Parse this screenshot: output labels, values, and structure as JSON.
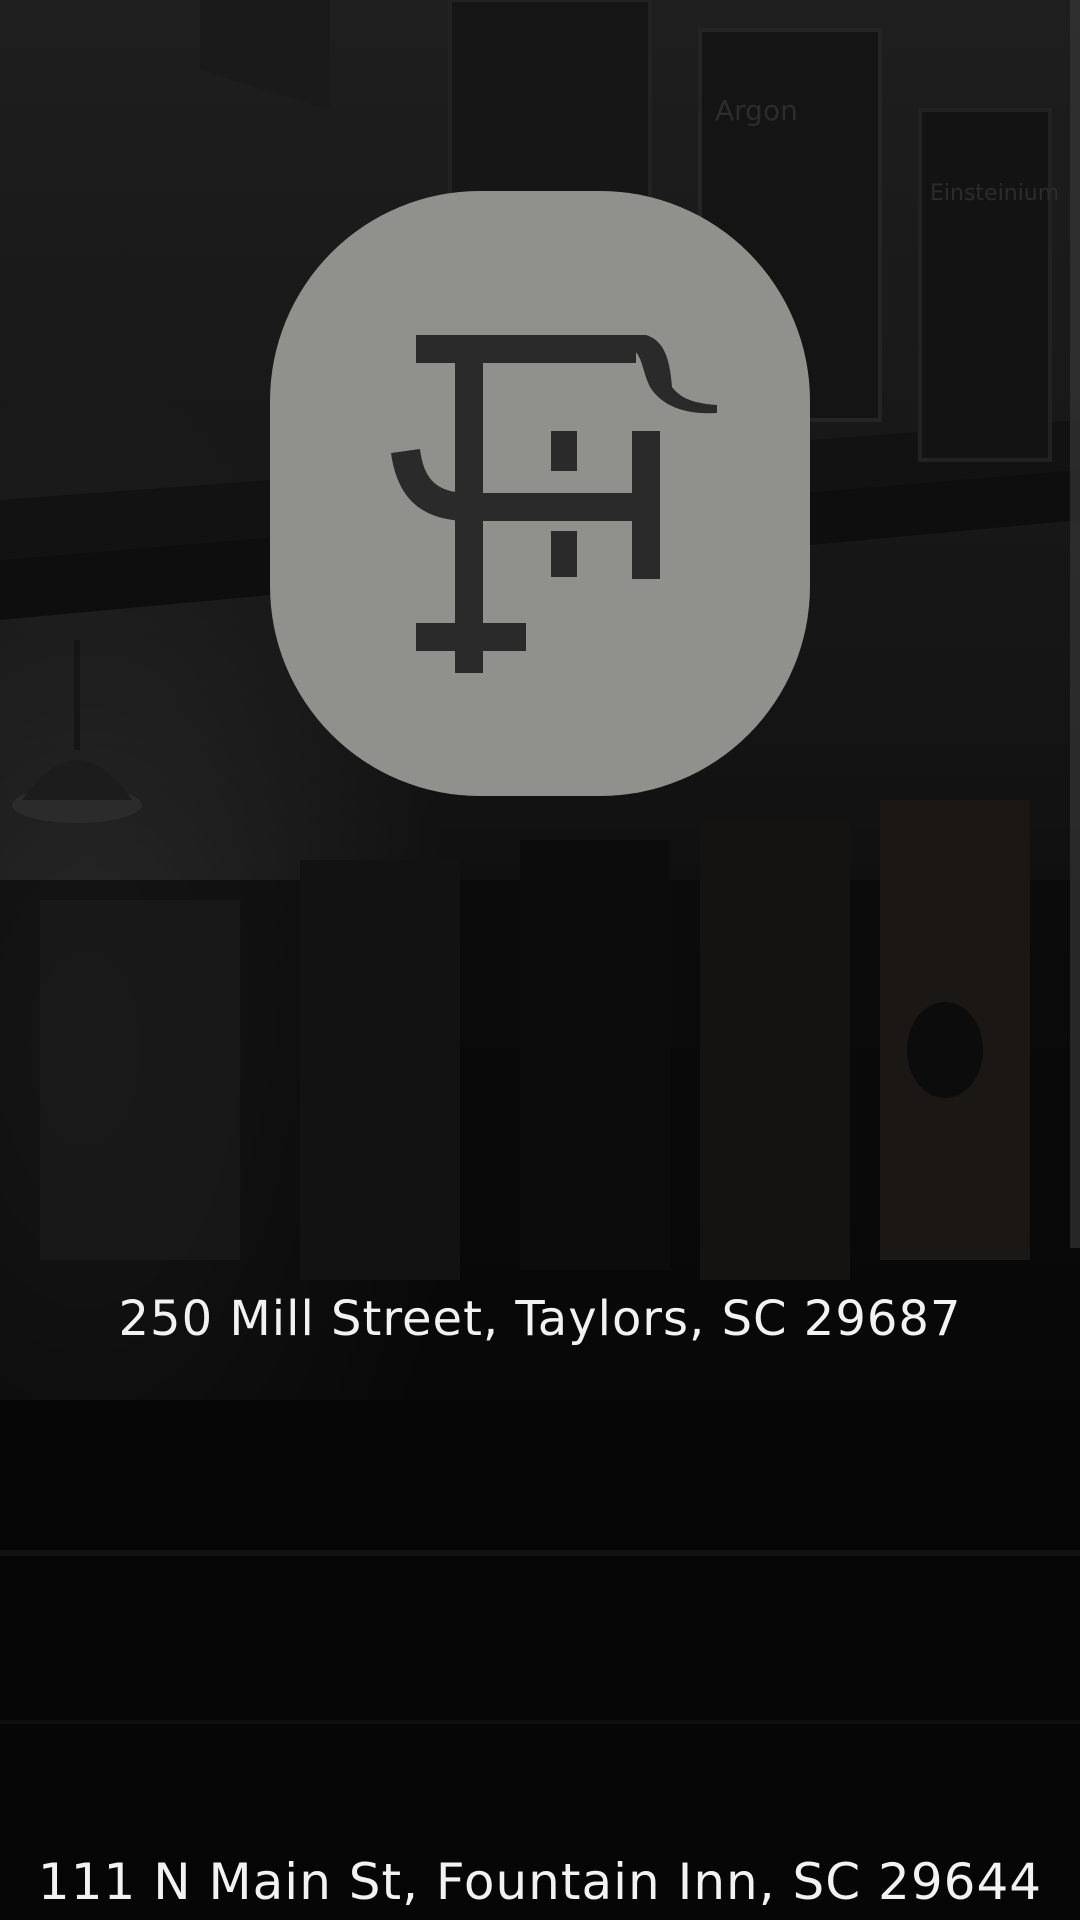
{
  "colors": {
    "background": "#0b0b0b",
    "logo_card": "#90918c",
    "logo_mark": "#2a2a2a",
    "text": "#f2f2f2"
  },
  "background_photo": {
    "icon": "restaurant-interior-photo"
  },
  "logo": {
    "icon": "tf-monogram-logo"
  },
  "locations": [
    {
      "address": "250 Mill Street, Taylors, SC 29687"
    },
    {
      "address": "111 N Main St, Fountain Inn, SC 29644"
    }
  ]
}
